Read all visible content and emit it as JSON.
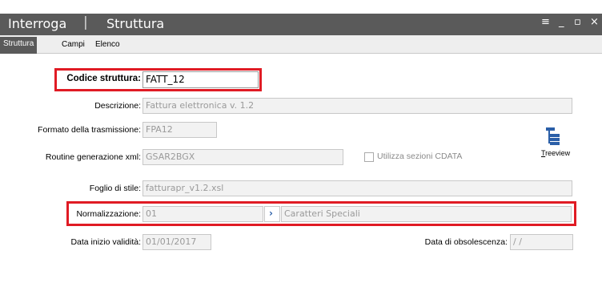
{
  "window": {
    "title_left": "Interroga",
    "separator": "|",
    "title_right": "Struttura",
    "ctrl_menu": "≡",
    "ctrl_min": "_",
    "ctrl_max": "▫",
    "ctrl_close": "×"
  },
  "tabs": [
    {
      "label": "Struttura",
      "active": true
    },
    {
      "label": "Campi",
      "active": false
    },
    {
      "label": "Elenco",
      "active": false
    }
  ],
  "form": {
    "codice_label": "Codice struttura:",
    "codice_value": "FATT_12",
    "descrizione_label": "Descrizione:",
    "descrizione_value": "Fattura elettronica v. 1.2",
    "formato_label": "Formato della trasmissione:",
    "formato_value": "FPA12",
    "routine_label": "Routine generazione xml:",
    "routine_value": "GSAR2BGX",
    "cdata_label": "Utilizza sezioni CDATA",
    "cdata_checked": false,
    "foglio_label": "Foglio di stile:",
    "foglio_value": "fatturapr_v1.2.xsl",
    "normalizzazione_label": "Normalizzazione:",
    "normalizzazione_code": "01",
    "normalizzazione_desc": "Caratteri Speciali",
    "data_inizio_label": "Data inizio validità:",
    "data_inizio_value": "01/01/2017",
    "data_obsol_label": "Data di obsolescenza:",
    "data_obsol_value": " /  / "
  },
  "treeview": {
    "first_letter": "T",
    "rest": "reeview",
    "icon": "treeview-icon"
  },
  "colors": {
    "titlebar": "#5a5a5a",
    "highlight": "#e01b24",
    "zoom_arrow": "#2b5fa8"
  }
}
